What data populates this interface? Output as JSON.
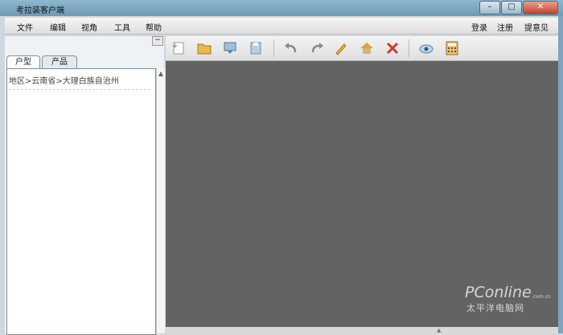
{
  "window": {
    "title": "考拉装客户端",
    "minimize": "–",
    "maximize": "□",
    "close": "✕"
  },
  "menu": {
    "items": [
      "文件",
      "编辑",
      "视角",
      "工具",
      "帮助"
    ],
    "right": [
      "登录",
      "注册",
      "提意见"
    ]
  },
  "toolbar": {
    "buttons": [
      "new-icon",
      "open-folder-icon",
      "download-icon",
      "save-icon",
      "undo-icon",
      "redo-icon",
      "edit-icon",
      "home-icon",
      "delete-icon",
      "view-icon",
      "calculator-icon"
    ]
  },
  "left_panel": {
    "collapse": "−",
    "tabs": [
      "户型",
      "产品"
    ],
    "breadcrumb": "地区>云南省>大理白族自治州"
  },
  "watermark": {
    "main": "PConline",
    "sub": ".com.cn",
    "cn": "太平洋电脑网"
  }
}
